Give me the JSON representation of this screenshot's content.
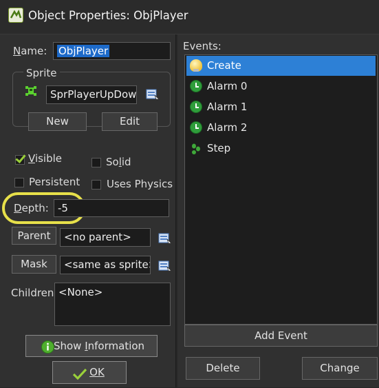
{
  "window": {
    "title": "Object Properties: ObjPlayer"
  },
  "name": {
    "label": "Name:",
    "value": "ObjPlayer"
  },
  "sprite": {
    "group_label": "Sprite",
    "value": "SprPlayerUpDown",
    "new_label": "New",
    "edit_label": "Edit"
  },
  "options": {
    "visible": {
      "label": "Visible",
      "checked": true
    },
    "solid": {
      "label": "Solid",
      "checked": false
    },
    "persistent": {
      "label": "Persistent",
      "checked": false
    },
    "uses_physics": {
      "label": "Uses Physics",
      "checked": false
    }
  },
  "depth": {
    "label": "Depth:",
    "value": "-5"
  },
  "parent": {
    "button_label": "Parent",
    "value": "<no parent>"
  },
  "mask": {
    "button_label": "Mask",
    "value": "<same as sprite>"
  },
  "children": {
    "label": "Children:",
    "value": "<None>"
  },
  "buttons": {
    "show_information": "Show Information",
    "ok": "OK"
  },
  "events": {
    "label": "Events:",
    "items": [
      {
        "label": "Create",
        "icon": "lightbulb-icon",
        "selected": true
      },
      {
        "label": "Alarm 0",
        "icon": "alarm-clock-icon"
      },
      {
        "label": "Alarm 1",
        "icon": "alarm-clock-icon"
      },
      {
        "label": "Alarm 2",
        "icon": "alarm-clock-icon"
      },
      {
        "label": "Step",
        "icon": "step-icon"
      }
    ],
    "add_event": "Add Event",
    "delete": "Delete",
    "change": "Change"
  },
  "colors": {
    "selection": "#2d80d6",
    "highlight_circle": "#e7e04a",
    "checkmark": "#9ad03a"
  }
}
